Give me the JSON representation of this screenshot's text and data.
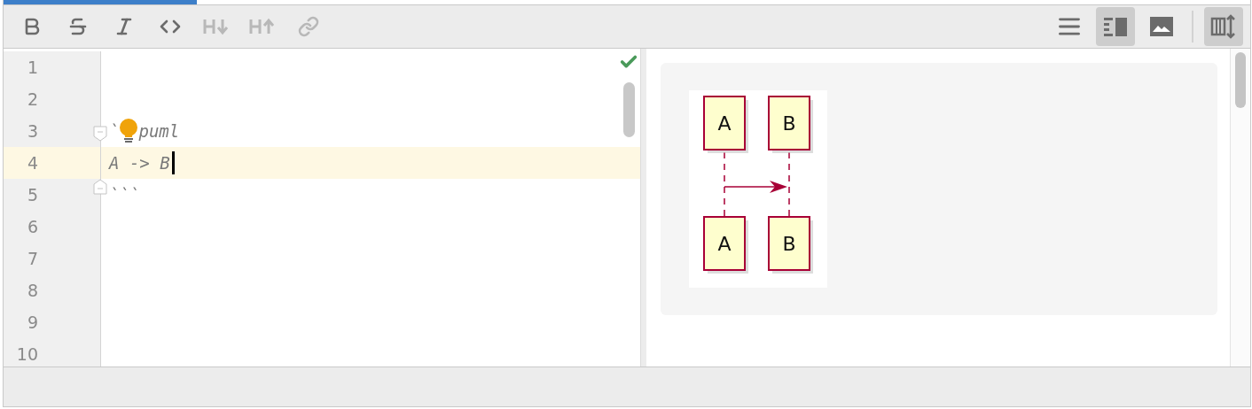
{
  "editor_tabs": [
    {
      "selected": true
    }
  ],
  "toolbar": {
    "format_buttons": [
      {
        "kind": "bold",
        "disabled": false
      },
      {
        "kind": "strikethrough",
        "disabled": false
      },
      {
        "kind": "italic",
        "disabled": false
      },
      {
        "kind": "code",
        "disabled": false
      },
      {
        "kind": "heading-down",
        "disabled": true
      },
      {
        "kind": "heading-up",
        "disabled": true
      },
      {
        "kind": "link",
        "disabled": true
      }
    ],
    "view_buttons": [
      {
        "kind": "editor",
        "selected": false
      },
      {
        "kind": "split",
        "selected": true
      },
      {
        "kind": "preview",
        "selected": false
      }
    ],
    "layout_toggle": {
      "selected": true
    }
  },
  "editor": {
    "valid": true,
    "lines": [
      {
        "number": "1",
        "current": false
      },
      {
        "number": "2",
        "current": false
      },
      {
        "number": "3",
        "current": false,
        "fold_start": true,
        "segments": [
          {
            "kind": "text",
            "text": "`"
          },
          {
            "kind": "bulb"
          },
          {
            "kind": "text",
            "text": "puml"
          }
        ]
      },
      {
        "number": "4",
        "current": true,
        "segments": [
          {
            "kind": "text",
            "text": "A -> B"
          },
          {
            "kind": "caret"
          }
        ]
      },
      {
        "number": "5",
        "current": false,
        "fold_end": true,
        "segments": [
          {
            "kind": "text",
            "text": "```"
          }
        ]
      },
      {
        "number": "6",
        "current": false
      },
      {
        "number": "7",
        "current": false
      },
      {
        "number": "8",
        "current": false
      },
      {
        "number": "9",
        "current": false
      },
      {
        "number": "10",
        "current": false
      }
    ]
  },
  "preview": {
    "diagram": {
      "participants_top": [
        "A",
        "B"
      ],
      "participants_bottom": [
        "A",
        "B"
      ],
      "message_arrow": true
    }
  }
}
